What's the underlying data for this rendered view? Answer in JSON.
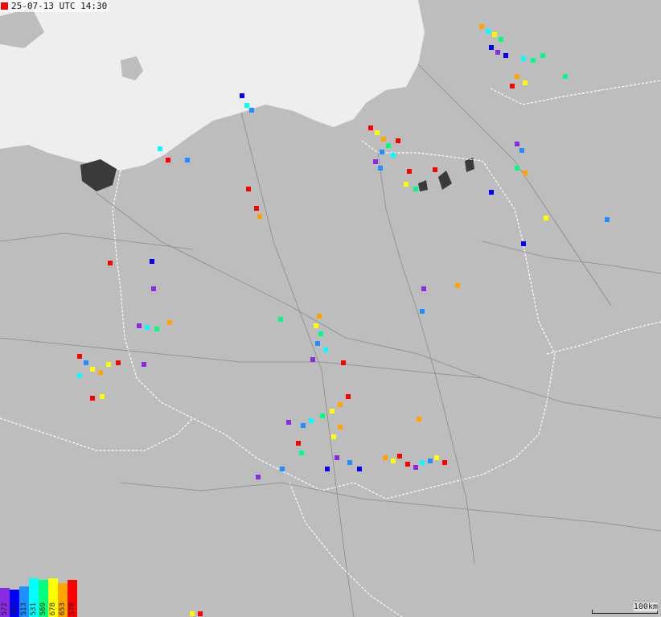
{
  "map": {
    "timestamp": "25-07-13 UTC 14:30",
    "live_color": "#ff0000",
    "sea_color": "#eeeeee",
    "land_color": "#bdbdbd",
    "lake_color": "#3a3a3a",
    "border_color": "#ffffff",
    "road_color": "#8a8a8a"
  },
  "legend": {
    "items": [
      {
        "label": "572",
        "color": "#8a2be2"
      },
      {
        "label": "461",
        "color": "#0000ff"
      },
      {
        "label": "513",
        "color": "#1e90ff"
      },
      {
        "label": "531",
        "color": "#00ffff"
      },
      {
        "label": "569",
        "color": "#00ff7f"
      },
      {
        "label": "678",
        "color": "#ffff00"
      },
      {
        "label": "653",
        "color": "#ffa500"
      },
      {
        "label": "578",
        "color": "#ff0000"
      }
    ]
  },
  "scale": {
    "label": "100km"
  }
}
